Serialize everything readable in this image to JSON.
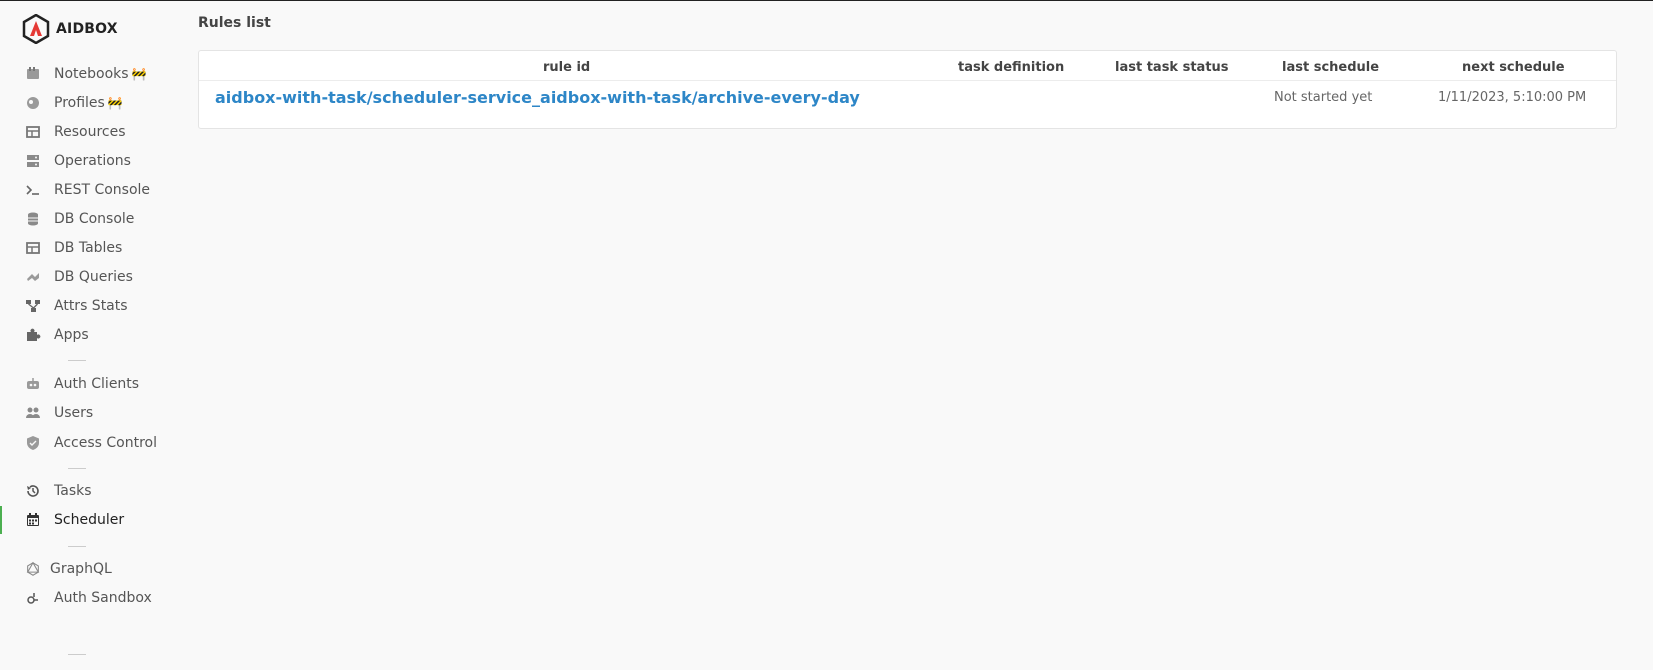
{
  "app": {
    "logo_text": "AIDBOX"
  },
  "sidebar": {
    "items": [
      {
        "label": "Notebooks",
        "badge": "🚧",
        "icon": "notebook-icon"
      },
      {
        "label": "Profiles",
        "badge": "🚧",
        "icon": "profile-icon"
      },
      {
        "label": "Resources",
        "icon": "resources-icon"
      },
      {
        "label": "Operations",
        "icon": "operations-icon"
      },
      {
        "label": "REST Console",
        "icon": "terminal-icon"
      },
      {
        "label": "DB Console",
        "icon": "database-icon"
      },
      {
        "label": "DB Tables",
        "icon": "table-icon"
      },
      {
        "label": "DB Queries",
        "icon": "query-icon"
      },
      {
        "label": "Attrs Stats",
        "icon": "tree-icon"
      },
      {
        "label": "Apps",
        "icon": "puzzle-icon"
      },
      {
        "label": "Auth Clients",
        "icon": "robot-icon"
      },
      {
        "label": "Users",
        "icon": "users-icon"
      },
      {
        "label": "Access Control",
        "icon": "shield-icon"
      },
      {
        "label": "Tasks",
        "icon": "history-icon"
      },
      {
        "label": "Scheduler",
        "icon": "calendar-icon"
      },
      {
        "label": "GraphQL",
        "icon": "graphql-icon"
      },
      {
        "label": "Auth Sandbox",
        "icon": "sandbox-icon"
      }
    ],
    "active": "Scheduler",
    "active_color": "#4caf50"
  },
  "main": {
    "title": "Rules list",
    "table": {
      "columns": [
        "rule id",
        "task definition",
        "last task status",
        "last schedule",
        "next schedule"
      ],
      "rows": [
        {
          "rule_id": "aidbox-with-task/scheduler-service_aidbox-with-task/archive-every-day",
          "task_definition": "",
          "last_task_status": "",
          "last_schedule": "Not started yet",
          "next_schedule": "1/11/2023, 5:10:00 PM"
        }
      ]
    },
    "link_color": "#2d86c7"
  }
}
